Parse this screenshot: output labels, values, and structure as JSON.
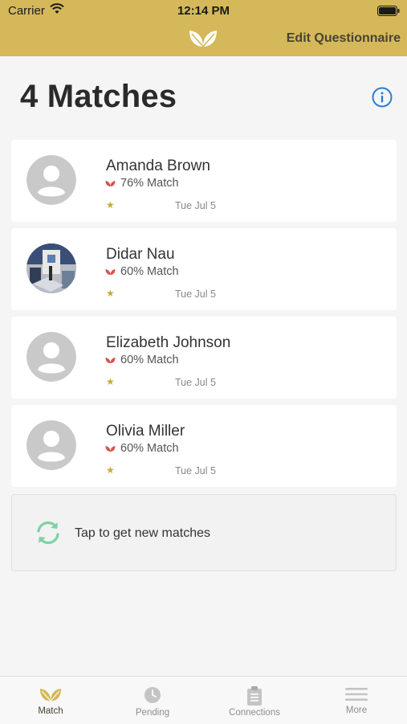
{
  "status_bar": {
    "carrier": "Carrier",
    "time": "12:14 PM"
  },
  "nav": {
    "edit_label": "Edit Questionnaire",
    "logo_icon": "leaf-logo-icon"
  },
  "page": {
    "title": "4 Matches",
    "info_icon": "info-icon"
  },
  "matches": [
    {
      "name": "Amanda Brown",
      "match": "76% Match",
      "date": "Tue Jul 5",
      "avatar": "placeholder"
    },
    {
      "name": "Didar Nau",
      "match": "60% Match",
      "date": "Tue Jul 5",
      "avatar": "photo"
    },
    {
      "name": "Elizabeth Johnson",
      "match": "60% Match",
      "date": "Tue Jul 5",
      "avatar": "placeholder"
    },
    {
      "name": "Olivia Miller",
      "match": "60% Match",
      "date": "Tue Jul 5",
      "avatar": "placeholder"
    }
  ],
  "refresh": {
    "label": "Tap to get new matches"
  },
  "tabs": [
    {
      "label": "Match",
      "icon": "leaf-icon",
      "active": true
    },
    {
      "label": "Pending",
      "icon": "clock-icon",
      "active": false
    },
    {
      "label": "Connections",
      "icon": "clipboard-icon",
      "active": false
    },
    {
      "label": "More",
      "icon": "menu-icon",
      "active": false
    }
  ],
  "colors": {
    "header": "#d4b85a",
    "accent_red": "#d9534f",
    "star": "#c9a93a",
    "info_blue": "#2f7bd6",
    "refresh_green": "#7fd1a6"
  }
}
